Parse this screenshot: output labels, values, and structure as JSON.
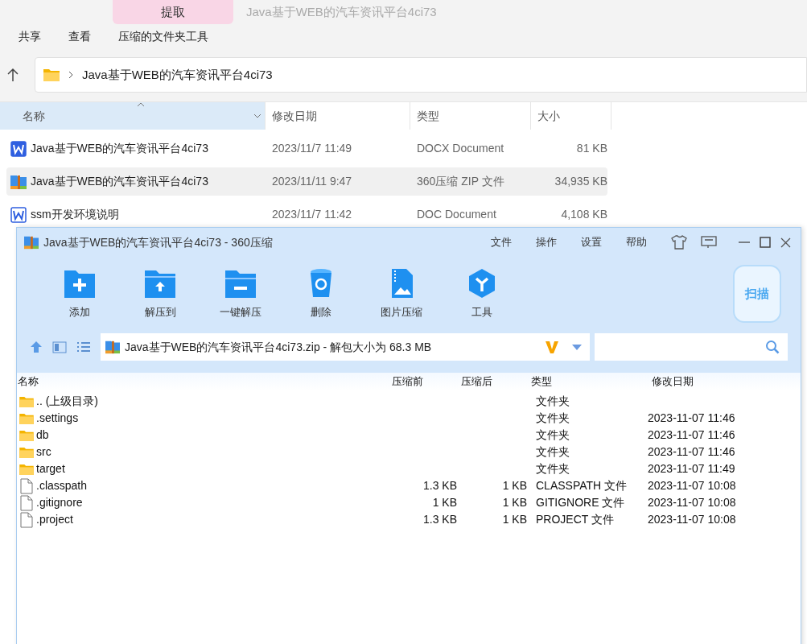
{
  "explorer": {
    "context_tab": {
      "label": "提取",
      "selected": true
    },
    "title": "Java基于WEB的汽车资讯平台4ci73",
    "ribbon_tabs": [
      "共享",
      "查看",
      "压缩的文件夹工具"
    ],
    "address": "Java基于WEB的汽车资讯平台4ci73",
    "columns": [
      {
        "label": "名称",
        "selected": true
      },
      {
        "label": "修改日期",
        "selected": false
      },
      {
        "label": "类型",
        "selected": false
      },
      {
        "label": "大小",
        "selected": false
      }
    ],
    "rows": [
      {
        "kind": "docx",
        "name": "Java基于WEB的汽车资讯平台4ci73",
        "modified": "2023/11/7 11:49",
        "type": "DOCX Document",
        "size": "81 KB",
        "selected": false
      },
      {
        "kind": "zip",
        "name": "Java基于WEB的汽车资讯平台4ci73",
        "modified": "2023/11/11 9:47",
        "type": "360压缩 ZIP 文件",
        "size": "34,935 KB",
        "selected": true
      },
      {
        "kind": "doc",
        "name": "ssm开发环境说明",
        "modified": "2023/11/7 11:42",
        "type": "DOC Document",
        "size": "4,108 KB",
        "selected": false
      }
    ]
  },
  "archive_window": {
    "title": "Java基于WEB的汽车资讯平台4ci73 - 360压缩",
    "menu": [
      "文件",
      "操作",
      "设置",
      "帮助"
    ],
    "toolbar": [
      {
        "kind": "add",
        "label": "添加"
      },
      {
        "kind": "extract_to",
        "label": "解压到"
      },
      {
        "kind": "one_click",
        "label": "一键解压"
      },
      {
        "kind": "delete",
        "label": "删除"
      },
      {
        "kind": "image",
        "label": "图片压缩"
      },
      {
        "kind": "tools",
        "label": "工具"
      }
    ],
    "scan_label": "扫描",
    "address": "Java基于WEB的汽车资讯平台4ci73.zip - 解包大小为 68.3 MB",
    "columns": [
      "名称",
      "压缩前",
      "压缩后",
      "类型",
      "修改日期"
    ],
    "files": [
      {
        "kind": "folder",
        "name": ".. (上级目录)",
        "type": "文件夹"
      },
      {
        "kind": "folder",
        "name": ".settings",
        "type": "文件夹",
        "modified": "2023-11-07 11:46"
      },
      {
        "kind": "folder",
        "name": "db",
        "type": "文件夹",
        "modified": "2023-11-07 11:46"
      },
      {
        "kind": "folder",
        "name": "src",
        "type": "文件夹",
        "modified": "2023-11-07 11:46"
      },
      {
        "kind": "folder",
        "name": "target",
        "type": "文件夹",
        "modified": "2023-11-07 11:49"
      },
      {
        "kind": "file",
        "name": ".classpath",
        "before": "1.3 KB",
        "after": "1 KB",
        "type": "CLASSPATH 文件",
        "modified": "2023-11-07 10:08"
      },
      {
        "kind": "file",
        "name": ".gitignore",
        "before": "1 KB",
        "after": "1 KB",
        "type": "GITIGNORE 文件",
        "modified": "2023-11-07 10:08"
      },
      {
        "kind": "file",
        "name": ".project",
        "before": "1.3 KB",
        "after": "1 KB",
        "type": "PROJECT 文件",
        "modified": "2023-11-07 10:08"
      }
    ]
  }
}
